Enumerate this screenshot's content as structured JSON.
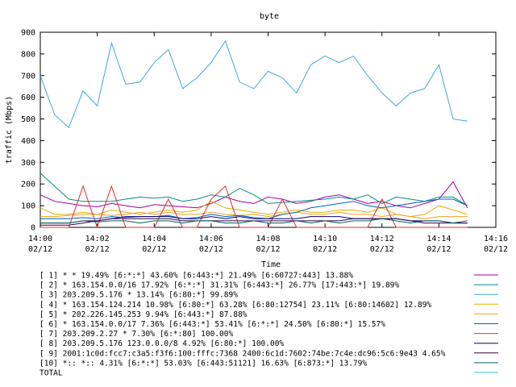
{
  "chart_data": {
    "type": "line",
    "title": "byte",
    "xlabel": "Time",
    "ylabel": "traffic (Mbps)",
    "ylim": [
      0,
      900
    ],
    "yticks": [
      "0",
      "100",
      "200",
      "300",
      "400",
      "500",
      "600",
      "700",
      "800",
      "900"
    ],
    "xlim_minutes": [
      0,
      16
    ],
    "xticks": [
      {
        "m": 0,
        "time": "14:00",
        "date": "02/12"
      },
      {
        "m": 2,
        "time": "14:02",
        "date": "02/12"
      },
      {
        "m": 4,
        "time": "14:04",
        "date": "02/12"
      },
      {
        "m": 6,
        "time": "14:06",
        "date": "02/12"
      },
      {
        "m": 8,
        "time": "14:08",
        "date": "02/12"
      },
      {
        "m": 10,
        "time": "14:10",
        "date": "02/12"
      },
      {
        "m": 12,
        "time": "14:12",
        "date": "02/12"
      },
      {
        "m": 14,
        "time": "14:14",
        "date": "02/12"
      },
      {
        "m": 16,
        "time": "14:16",
        "date": "02/12"
      }
    ],
    "x": [
      "14:00:00",
      "14:00:30",
      "14:01:00",
      "14:01:30",
      "14:02:00",
      "14:02:30",
      "14:03:00",
      "14:03:30",
      "14:04:00",
      "14:04:30",
      "14:05:00",
      "14:05:30",
      "14:06:00",
      "14:06:30",
      "14:07:00",
      "14:07:30",
      "14:08:00",
      "14:08:30",
      "14:09:00",
      "14:09:30",
      "14:10:00",
      "14:10:30",
      "14:11:00",
      "14:11:30",
      "14:12:00",
      "14:12:30",
      "14:13:00",
      "14:13:30",
      "14:14:00",
      "14:14:30",
      "14:15:00"
    ],
    "series": [
      {
        "name": "[ 1] * * 19.49%  [6:*:*] 43.60% [6:443:*] 21.49% [6:60727:443] 13.88%",
        "color": "#a000a0",
        "values": [
          150,
          120,
          110,
          100,
          95,
          110,
          100,
          90,
          105,
          100,
          95,
          90,
          110,
          140,
          120,
          110,
          140,
          130,
          110,
          120,
          140,
          150,
          130,
          110,
          120,
          100,
          90,
          110,
          130,
          210,
          90
        ]
      },
      {
        "name": "[ 2] * 163.154.0.0/16 17.92%  [6:*:*] 31.31% [6:443:*] 26.77% [17:443:*] 19.89%",
        "color": "#009080",
        "values": [
          250,
          190,
          130,
          120,
          120,
          120,
          130,
          140,
          135,
          140,
          120,
          130,
          150,
          140,
          180,
          150,
          110,
          115,
          120,
          125,
          130,
          140,
          130,
          150,
          110,
          140,
          130,
          120,
          140,
          140,
          100
        ]
      },
      {
        "name": "[ 3] 203.209.5.176 * 13.14%  [6:80:*] 99.89%",
        "color": "#40a8d8",
        "values": [
          700,
          520,
          460,
          630,
          560,
          850,
          660,
          670,
          760,
          820,
          640,
          690,
          760,
          860,
          670,
          640,
          720,
          690,
          620,
          750,
          790,
          760,
          790,
          700,
          620,
          560,
          620,
          640,
          750,
          500,
          490
        ]
      },
      {
        "name": "[ 4] * 163.154.124.214 10.98%  [6:80:*] 63.28% [6:80:12754] 23.11% [6:80:14602] 12.89%",
        "color": "#e0b000",
        "values": [
          90,
          60,
          60,
          70,
          60,
          80,
          70,
          60,
          70,
          80,
          70,
          80,
          120,
          90,
          80,
          70,
          60,
          70,
          80,
          70,
          70,
          80,
          80,
          70,
          90,
          60,
          50,
          60,
          100,
          80,
          60
        ]
      },
      {
        "name": "[ 5] * 202.226.145.253 9.94%  [6:443:*] 87.88%",
        "color": "#f0a020",
        "values": [
          50,
          50,
          55,
          60,
          60,
          55,
          60,
          70,
          60,
          70,
          60,
          60,
          70,
          60,
          55,
          60,
          50,
          60,
          70,
          60,
          60,
          70,
          60,
          60,
          50,
          60,
          50,
          40,
          50,
          50,
          50
        ]
      },
      {
        "name": "[ 6] * 163.154.0.0/17 7.36%  [6:443:*] 53.41% [6:*:*] 24.50% [6:80:*] 15.57%",
        "color": "#0060c0",
        "values": [
          40,
          40,
          40,
          45,
          40,
          50,
          45,
          50,
          50,
          55,
          40,
          45,
          60,
          50,
          55,
          45,
          40,
          60,
          70,
          90,
          100,
          110,
          120,
          100,
          90,
          100,
          110,
          120,
          130,
          130,
          100
        ]
      },
      {
        "name": "[ 7] 203.209.2.27 * 7.30%  [6:*:80] 100.00%",
        "color": "#e03030",
        "values": [
          0,
          0,
          0,
          190,
          0,
          190,
          0,
          0,
          0,
          130,
          0,
          0,
          130,
          190,
          0,
          0,
          0,
          130,
          0,
          0,
          0,
          0,
          0,
          0,
          130,
          0,
          0,
          0,
          0,
          0,
          0
        ]
      },
      {
        "name": "[ 8] 203.209.5.176 123.0.0.0/8 4.92%  [6:80:*] 100.00%",
        "color": "#000080",
        "values": [
          20,
          20,
          20,
          30,
          30,
          40,
          50,
          50,
          50,
          50,
          40,
          40,
          50,
          40,
          50,
          40,
          40,
          40,
          40,
          50,
          50,
          50,
          40,
          40,
          40,
          40,
          30,
          30,
          30,
          20,
          20
        ]
      },
      {
        "name": "[ 9] 2001:1c0d:fcc7:c3a5:f3f6:100:fffc:7368 2400:6c1d:7602:74be:7c4e:dc96:5c6:9e43 4.65%",
        "color": "#300040",
        "values": [
          10,
          10,
          10,
          20,
          30,
          40,
          40,
          40,
          40,
          40,
          30,
          30,
          30,
          30,
          30,
          30,
          30,
          30,
          30,
          30,
          30,
          30,
          40,
          40,
          40,
          40,
          30,
          20,
          20,
          20,
          20
        ]
      },
      {
        "name": "[10] *:: *:: 4.31%  [6:*:*] 53.03% [6:443:51121] 16.63% [6:873:*] 13.79%",
        "color": "#006060",
        "values": [
          20,
          20,
          20,
          30,
          25,
          30,
          30,
          20,
          30,
          30,
          20,
          30,
          30,
          20,
          20,
          30,
          20,
          20,
          30,
          20,
          30,
          20,
          30,
          30,
          40,
          30,
          20,
          30,
          30,
          20,
          30
        ]
      },
      {
        "name": "TOTAL",
        "color": "#40b8d8"
      }
    ]
  }
}
